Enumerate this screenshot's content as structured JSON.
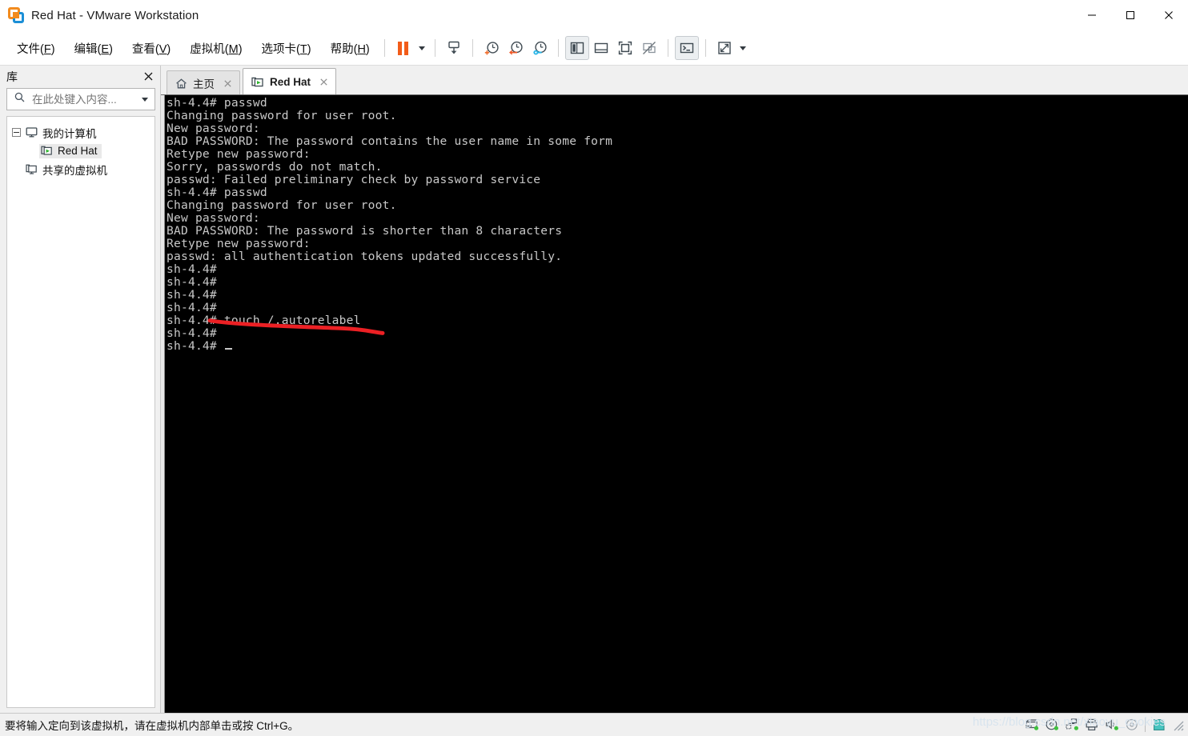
{
  "window": {
    "title": "Red Hat - VMware Workstation",
    "logo_icon": "vmware-logo-icon",
    "minimize_label": "—",
    "maximize_label": "☐",
    "close_label": "✕"
  },
  "menubar": {
    "items": [
      {
        "label": "文件(F)",
        "pre": "文件(",
        "key": "F",
        "post": ")",
        "name": "menu-file"
      },
      {
        "label": "编辑(E)",
        "pre": "编辑(",
        "key": "E",
        "post": ")",
        "name": "menu-edit"
      },
      {
        "label": "查看(V)",
        "pre": "查看(",
        "key": "V",
        "post": ")",
        "name": "menu-view"
      },
      {
        "label": "虚拟机(M)",
        "pre": "虚拟机(",
        "key": "M",
        "post": ")",
        "name": "menu-vm"
      },
      {
        "label": "选项卡(T)",
        "pre": "选项卡(",
        "key": "T",
        "post": ")",
        "name": "menu-tabs"
      },
      {
        "label": "帮助(H)",
        "pre": "帮助(",
        "key": "H",
        "post": ")",
        "name": "menu-help"
      }
    ]
  },
  "toolbar": {
    "buttons": [
      {
        "name": "suspend-button",
        "icon": "pause-icon",
        "pressed": false
      },
      {
        "name": "power-dropdown",
        "icon": "chevron-down-icon",
        "pressed": false
      },
      {
        "name": "send-ctrl-alt-del-button",
        "icon": "send-ctrl-alt-del-icon",
        "pressed": false
      },
      {
        "name": "take-snapshot-button",
        "icon": "snapshot-add-icon",
        "pressed": false
      },
      {
        "name": "revert-snapshot-button",
        "icon": "snapshot-revert-icon",
        "pressed": false
      },
      {
        "name": "manage-snapshots-button",
        "icon": "snapshot-manage-icon",
        "pressed": false
      },
      {
        "name": "show-library-button",
        "icon": "sidebar-panel-icon",
        "pressed": true
      },
      {
        "name": "show-thumbnail-bar-button",
        "icon": "bottom-panel-icon",
        "pressed": false
      },
      {
        "name": "full-screen-button",
        "icon": "fullscreen-frame-icon",
        "pressed": false
      },
      {
        "name": "unity-mode-button",
        "icon": "unity-disabled-icon",
        "pressed": false
      },
      {
        "name": "console-view-button",
        "icon": "console-prompt-icon",
        "pressed": true
      },
      {
        "name": "stretch-view-button",
        "icon": "expand-arrows-icon",
        "pressed": false
      },
      {
        "name": "stretch-dropdown",
        "icon": "chevron-down-icon",
        "pressed": false
      }
    ]
  },
  "sidebar": {
    "title": "库",
    "close_icon": "close-icon",
    "search": {
      "placeholder": "在此处键入内容...",
      "value": "",
      "icon": "search-icon",
      "dropdown_icon": "chevron-down-icon"
    },
    "tree": [
      {
        "label": "我的计算机",
        "icon": "monitor-icon",
        "level": 0,
        "expanded": true,
        "selected": false,
        "name": "tree-item-my-computer"
      },
      {
        "label": "Red Hat",
        "icon": "vm-running-icon",
        "level": 1,
        "expanded": false,
        "selected": true,
        "name": "tree-item-red-hat"
      },
      {
        "label": "共享的虚拟机",
        "icon": "shared-vm-icon",
        "level": 0,
        "expanded": false,
        "selected": false,
        "name": "tree-item-shared-vms"
      }
    ]
  },
  "tabs": [
    {
      "label": "主页",
      "icon": "home-icon",
      "active": false,
      "name": "tab-home"
    },
    {
      "label": "Red Hat",
      "icon": "vm-running-icon",
      "active": true,
      "name": "tab-red-hat"
    }
  ],
  "terminal": {
    "background": "#000000",
    "foreground": "#c8c8c8",
    "lines": [
      "sh-4.4# passwd",
      "Changing password for user root.",
      "New password:",
      "BAD PASSWORD: The password contains the user name in some form",
      "Retype new password:",
      "Sorry, passwords do not match.",
      "passwd: Failed preliminary check by password service",
      "sh-4.4# passwd",
      "Changing password for user root.",
      "New password:",
      "BAD PASSWORD: The password is shorter than 8 characters",
      "Retype new password:",
      "passwd: all authentication tokens updated successfully.",
      "sh-4.4#",
      "sh-4.4#",
      "sh-4.4#",
      "sh-4.4#",
      "sh-4.4# touch /.autorelabel",
      "sh-4.4#"
    ],
    "prompt_last": "sh-4.4# ",
    "cursor": "_"
  },
  "annotation": {
    "type": "underline-stroke",
    "color": "#ec2024",
    "target_text": "touch /.autorelabel"
  },
  "statusbar": {
    "message": "要将输入定向到该虚拟机，请在虚拟机内部单击或按 Ctrl+G。",
    "watermark": "https://blog.csdn.net/xiaoyu_cookies",
    "icons": [
      {
        "name": "status-hard-disk-icon",
        "icon": "hard-disk-icon",
        "connected": true
      },
      {
        "name": "status-cd-dvd-icon",
        "icon": "cd-dvd-icon",
        "connected": true
      },
      {
        "name": "status-network-icon",
        "icon": "network-icon",
        "connected": true
      },
      {
        "name": "status-printer-icon",
        "icon": "printer-icon",
        "connected": false
      },
      {
        "name": "status-sound-icon",
        "icon": "sound-icon",
        "connected": true
      },
      {
        "name": "status-optical-icon",
        "icon": "optical-drive-icon",
        "connected": false
      },
      {
        "name": "status-vmware-tools-icon",
        "icon": "vmware-tools-icon",
        "connected": false
      }
    ]
  }
}
